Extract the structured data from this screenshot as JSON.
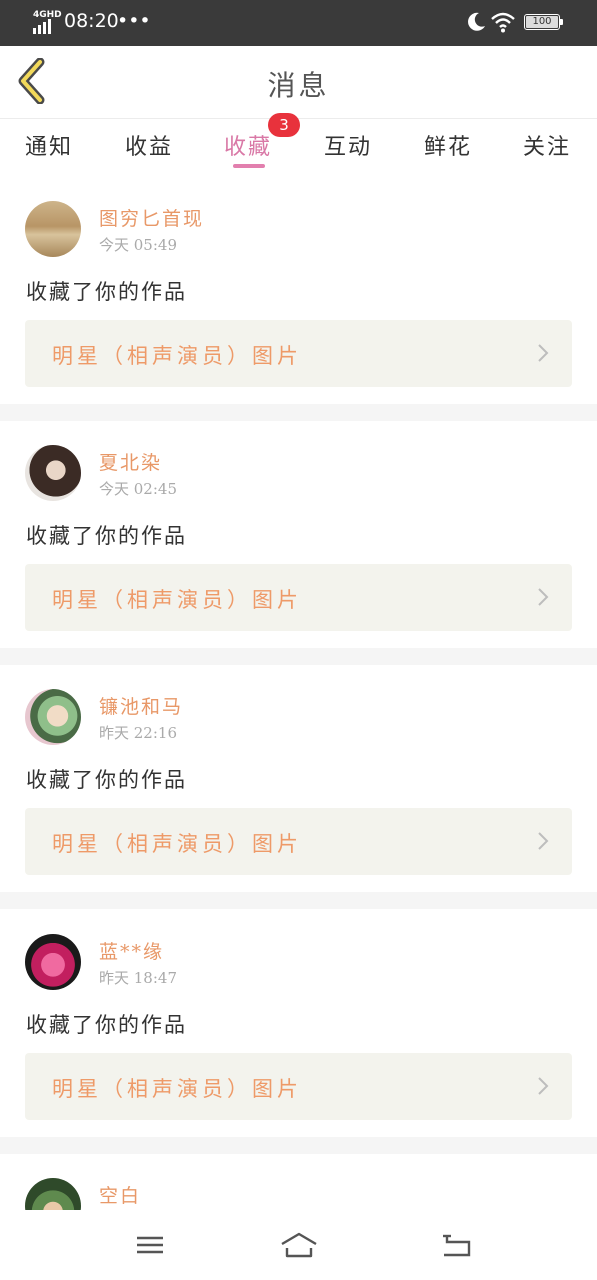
{
  "status_bar": {
    "network": "4GHD",
    "time": "08:20",
    "dots": "•••",
    "battery": "100",
    "icons": [
      "signal-icon",
      "moon-icon",
      "wifi-icon",
      "battery-icon"
    ]
  },
  "header": {
    "title": "消息",
    "back_icon": "chevron-left-icon"
  },
  "tabs": [
    {
      "label": "通知"
    },
    {
      "label": "收益"
    },
    {
      "label": "收藏",
      "badge": "3",
      "active": true
    },
    {
      "label": "互动"
    },
    {
      "label": "鲜花"
    },
    {
      "label": "关注"
    }
  ],
  "messages": [
    {
      "user": "图穷匕首现",
      "time": "今天 05:49",
      "action": "收藏了你的作品",
      "work": "明星（相声演员）图片"
    },
    {
      "user": "夏北染",
      "time": "今天 02:45",
      "action": "收藏了你的作品",
      "work": "明星（相声演员）图片"
    },
    {
      "user": "镰池和马",
      "time": "昨天 22:16",
      "action": "收藏了你的作品",
      "work": "明星（相声演员）图片"
    },
    {
      "user": "蓝**缘",
      "time": "昨天 18:47",
      "action": "收藏了你的作品",
      "work": "明星（相声演员）图片"
    },
    {
      "user": "空白"
    }
  ],
  "nav": {
    "icons": [
      "menu-icon",
      "home-icon",
      "back-icon"
    ]
  },
  "colors": {
    "accent": "#e27fae",
    "name": "#e89868",
    "work": "#ee9a68",
    "badge": "#e8323c"
  }
}
